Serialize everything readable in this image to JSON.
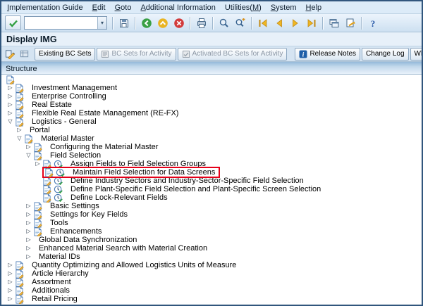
{
  "menu_bar": {
    "items": [
      {
        "label": "Implementation Guide",
        "mnemonic": "I"
      },
      {
        "label": "Edit",
        "mnemonic": "E"
      },
      {
        "label": "Goto",
        "mnemonic": "G"
      },
      {
        "label": "Additional Information",
        "mnemonic": "A"
      },
      {
        "label": "Utilities(M)",
        "mnemonic": "M"
      },
      {
        "label": "System",
        "mnemonic": "S"
      },
      {
        "label": "Help",
        "mnemonic": "H"
      }
    ]
  },
  "standard_toolbar": {
    "command_field": {
      "value": ""
    },
    "icon_groups": [
      [
        "save"
      ],
      [
        "back",
        "exit",
        "cancel"
      ],
      [
        "print"
      ],
      [
        "find",
        "find-next"
      ],
      [
        "first-page",
        "previous-page",
        "next-page",
        "last-page"
      ],
      [
        "new-session",
        "create-shortcut"
      ],
      [
        "help"
      ]
    ]
  },
  "title_bar": {
    "title": "Display IMG"
  },
  "app_toolbar": {
    "left_icons": [
      "document-pencil",
      "grid"
    ],
    "buttons": [
      {
        "label": "Existing BC Sets",
        "disabled": false,
        "icon": null,
        "group_start": false
      },
      {
        "label": "BC Sets for Activity",
        "disabled": true,
        "icon": "bc-set",
        "group_start": false
      },
      {
        "label": "Activated BC Sets for Activity",
        "disabled": true,
        "icon": "bc-set-check",
        "group_start": false
      },
      {
        "label": "Release Notes",
        "disabled": false,
        "icon": "info",
        "group_start": true
      },
      {
        "label": "Change Log",
        "disabled": false,
        "icon": null,
        "group_start": false
      },
      {
        "label": "Where Else Used",
        "disabled": false,
        "icon": null,
        "group_start": false
      }
    ]
  },
  "structure_panel": {
    "header": "Structure",
    "root_icon": "doc",
    "highlight_color": "#e50019",
    "tree": [
      {
        "level": 0,
        "arrow": "closed",
        "icons": [
          "doc"
        ],
        "label": "Investment Management",
        "highlighted": false
      },
      {
        "level": 0,
        "arrow": "closed",
        "icons": [
          "doc"
        ],
        "label": "Enterprise Controlling",
        "highlighted": false
      },
      {
        "level": 0,
        "arrow": "closed",
        "icons": [
          "doc"
        ],
        "label": "Real Estate",
        "highlighted": false
      },
      {
        "level": 0,
        "arrow": "closed",
        "icons": [
          "doc"
        ],
        "label": "Flexible Real Estate Management (RE-FX)",
        "highlighted": false
      },
      {
        "level": 0,
        "arrow": "open",
        "icons": [
          "doc"
        ],
        "label": "Logistics - General",
        "highlighted": false
      },
      {
        "level": 1,
        "arrow": "closed",
        "icons": [],
        "label": "Portal",
        "highlighted": false
      },
      {
        "level": 1,
        "arrow": "open",
        "icons": [
          "doc"
        ],
        "label": "Material Master",
        "highlighted": false
      },
      {
        "level": 2,
        "arrow": "closed",
        "icons": [
          "doc"
        ],
        "label": "Configuring the Material Master",
        "highlighted": false
      },
      {
        "level": 2,
        "arrow": "open",
        "icons": [
          "doc"
        ],
        "label": "Field Selection",
        "highlighted": false
      },
      {
        "level": 3,
        "arrow": "closed",
        "icons": [
          "doc",
          "activity"
        ],
        "label": "Assign Fields to Field Selection Groups",
        "highlighted": false
      },
      {
        "level": 3,
        "arrow": "none",
        "icons": [
          "doc",
          "activity"
        ],
        "label": "Maintain Field Selection for Data Screens",
        "highlighted": true
      },
      {
        "level": 3,
        "arrow": "none",
        "icons": [
          "doc",
          "activity"
        ],
        "label": "Define Industry Sectors and Industry-Sector-Specific Field Selection",
        "highlighted": false
      },
      {
        "level": 3,
        "arrow": "none",
        "icons": [
          "doc",
          "activity"
        ],
        "label": "Define Plant-Specific Field Selection and Plant-Specific Screen Selection",
        "highlighted": false
      },
      {
        "level": 3,
        "arrow": "none",
        "icons": [
          "doc",
          "activity"
        ],
        "label": "Define Lock-Relevant Fields",
        "highlighted": false
      },
      {
        "level": 2,
        "arrow": "closed",
        "icons": [
          "doc"
        ],
        "label": "Basic Settings",
        "highlighted": false
      },
      {
        "level": 2,
        "arrow": "closed",
        "icons": [
          "doc"
        ],
        "label": "Settings for Key Fields",
        "highlighted": false
      },
      {
        "level": 2,
        "arrow": "closed",
        "icons": [
          "doc"
        ],
        "label": "Tools",
        "highlighted": false
      },
      {
        "level": 2,
        "arrow": "closed",
        "icons": [
          "doc"
        ],
        "label": "Enhancements",
        "highlighted": false
      },
      {
        "level": 2,
        "arrow": "closed",
        "icons": [],
        "label": "Global Data Synchronization",
        "highlighted": false
      },
      {
        "level": 2,
        "arrow": "closed",
        "icons": [],
        "label": "Enhanced Material Search with Material Creation",
        "highlighted": false
      },
      {
        "level": 2,
        "arrow": "closed",
        "icons": [],
        "label": "Material IDs",
        "highlighted": false
      },
      {
        "level": 0,
        "arrow": "closed",
        "icons": [
          "doc"
        ],
        "label": "Quantity Optimizing and Allowed Logistics Units of Measure",
        "highlighted": false
      },
      {
        "level": 0,
        "arrow": "closed",
        "icons": [
          "doc"
        ],
        "label": "Article Hierarchy",
        "highlighted": false
      },
      {
        "level": 0,
        "arrow": "closed",
        "icons": [
          "doc"
        ],
        "label": "Assortment",
        "highlighted": false
      },
      {
        "level": 0,
        "arrow": "closed",
        "icons": [
          "doc"
        ],
        "label": "Additionals",
        "highlighted": false
      },
      {
        "level": 0,
        "arrow": "closed",
        "icons": [
          "doc"
        ],
        "label": "Retail Pricing",
        "highlighted": false
      }
    ]
  },
  "colors": {
    "highlight_red": "#e50019",
    "header_blue": "#95b9da",
    "toolbar_blue": "#cde0f1"
  }
}
